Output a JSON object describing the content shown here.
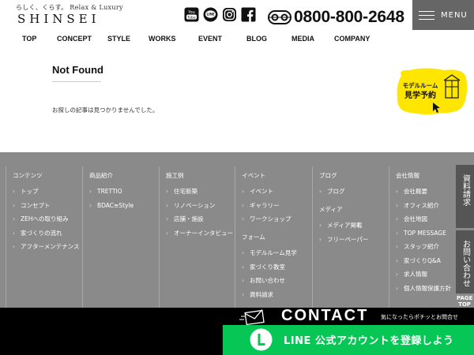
{
  "header": {
    "tagline": "らしく、くらす。 Relax & Luxury",
    "logo": "SHINSEI",
    "phone": "0800-800-2648",
    "menu_label": "MENU",
    "sns": [
      "youtube-icon",
      "line-icon",
      "instagram-icon",
      "facebook-icon"
    ]
  },
  "nav": [
    "TOP",
    "CONCEPT",
    "STYLE",
    "WORKS",
    "EVENT",
    "BLOG",
    "MEDIA",
    "COMPANY"
  ],
  "main": {
    "title": "Not Found",
    "message": "お探しの記事は見つかりませんでした。",
    "badge": {
      "line1": "モデルルーム",
      "line2": "見学予約"
    }
  },
  "footer": {
    "columns": [
      {
        "head": "コンテンツ",
        "items": [
          "トップ",
          "コンセプト",
          "ZEHへの取り組み",
          "家づくりの流れ",
          "アフターメンテナンス"
        ]
      },
      {
        "head": "商品紹介",
        "items": [
          "TRETTIO",
          "BDAC≡Style"
        ]
      },
      {
        "head": "施工例",
        "items": [
          "住宅新築",
          "リノベーション",
          "店舗・施設",
          "オーナーインタビュー"
        ]
      },
      {
        "head": "イベント",
        "items": [
          "イベント",
          "ギャラリー",
          "ワークショップ"
        ],
        "sub_head": "フォーム",
        "sub_items": [
          "モデルルーム見学",
          "家づくり教室",
          "お問い合わせ",
          "資料請求"
        ]
      },
      {
        "head": "ブログ",
        "items": [
          "ブログ"
        ],
        "sub_head": "メディア",
        "sub_items": [
          "メディア掲載",
          "フリーペーパー"
        ]
      },
      {
        "head": "会社情報",
        "items": [
          "会社概要",
          "オフィス紹介",
          "会社地図",
          "TOP MESSAGE",
          "スタッフ紹介",
          "家づくりQ&A",
          "求人情報",
          "個人情報保護方針"
        ]
      }
    ],
    "side_tabs": [
      "資料請求",
      "お問い合わせ"
    ],
    "pagetop": "PAGE TOP"
  },
  "contact": {
    "title": "CONTACT",
    "note": "気になったらポチッとお問合せ",
    "line_button": "LINE 公式アカウントを登録しよう"
  },
  "colors": {
    "footer_bg": "#8a8a8a",
    "badge_yellow": "#ffe600",
    "line_green": "#06c755",
    "menu_bg": "#666666"
  }
}
